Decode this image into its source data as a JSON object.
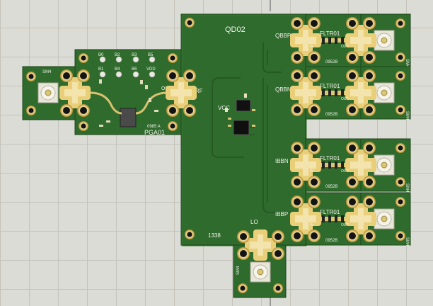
{
  "colors": {
    "grid_background": "#dcdcd6",
    "grid_lines": "#c4c4bd",
    "board_green": "#2f6b2c",
    "board_dark": "#1f4a1c",
    "pad_gold": "#e6c86a",
    "pad_light": "#f1e6b8",
    "hole_dark": "#141414",
    "silk": "#f2f2ec"
  },
  "boards": {
    "main": {
      "name": "QD02",
      "code": "1338",
      "labels": [
        "RF",
        "VCC",
        "LO",
        "QBBP",
        "QBBN",
        "IBBN",
        "IBBP"
      ]
    },
    "amp": {
      "name": "PGA01",
      "code": "0985 A",
      "pin_in": "IN",
      "pin_out": "OUT",
      "pads": [
        "B0",
        "B2",
        "B3",
        "B5",
        "B1",
        "B4",
        "B6",
        "VDD"
      ]
    },
    "connector_left": {
      "name": "SM4"
    },
    "connector_bottom": {
      "name": "SM4"
    },
    "filters": [
      {
        "name": "FLTR01",
        "code": "0952B",
        "connector": "SM4",
        "pin_in": "IN",
        "pin_out": "OUT"
      },
      {
        "name": "FLTR01",
        "code": "0952B",
        "connector": "SM4",
        "pin_in": "IN",
        "pin_out": "OUT"
      },
      {
        "name": "FLTR01",
        "code": "0952B",
        "connector": "SM4",
        "pin_in": "IN",
        "pin_out": "OUT"
      },
      {
        "name": "FLTR01",
        "code": "0952B",
        "connector": "SM4",
        "pin_in": "IN",
        "pin_out": "OUT"
      }
    ]
  }
}
